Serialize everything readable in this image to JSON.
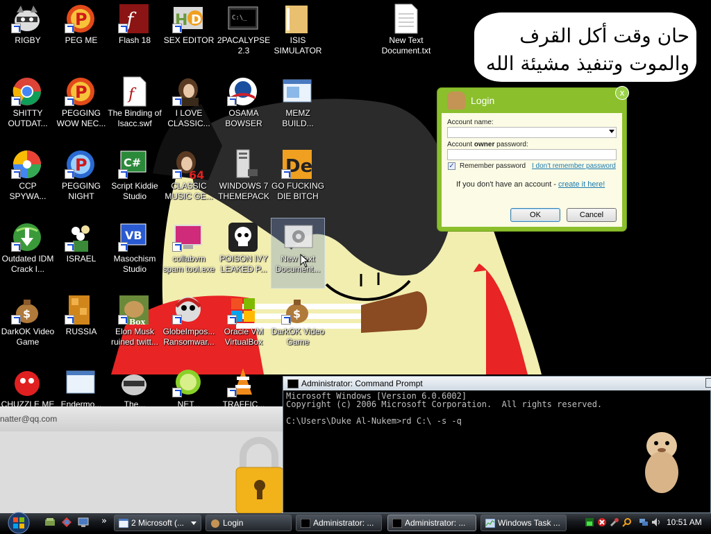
{
  "desktop": {
    "icons": [
      {
        "label": "RIGBY"
      },
      {
        "label": "PEG ME"
      },
      {
        "label": "Flash 18"
      },
      {
        "label": "SEX EDITOR"
      },
      {
        "label": "2PACALYPSE 2.3"
      },
      {
        "label": "ISIS SIMULATOR"
      },
      {
        "label": "New Text Document.txt"
      },
      {
        "label": "SHITTY OUTDAT..."
      },
      {
        "label": "PEGGING WOW NEC..."
      },
      {
        "label": "The Binding of Isacc.swf"
      },
      {
        "label": "I LOVE CLASSIC..."
      },
      {
        "label": "OSAMA BOWSER"
      },
      {
        "label": "MEMZ BUILD..."
      },
      {
        "label": "CCP SPYWA..."
      },
      {
        "label": "PEGGING NIGHT"
      },
      {
        "label": "Script Kiddie Studio"
      },
      {
        "label": "CLASSIC MUSIC GE..."
      },
      {
        "label": "WINDOWS 7 THEMEPACK"
      },
      {
        "label": "GO FUCKING DIE BITCH"
      },
      {
        "label": "Outdated IDM Crack I..."
      },
      {
        "label": "ISRAEL"
      },
      {
        "label": "Masochism Studio"
      },
      {
        "label": "collabvm spam tool.exe"
      },
      {
        "label": "POISON IVY LEAKED P..."
      },
      {
        "label": "New Text Document..."
      },
      {
        "label": "DarkOK Video Game"
      },
      {
        "label": "RUSSIA"
      },
      {
        "label": "Elon Musk ruined twitt..."
      },
      {
        "label": "GlobeImpos... Ransomwar..."
      },
      {
        "label": "Oracle VM VirtualBox"
      },
      {
        "label": "DarkOK Video Game"
      },
      {
        "label": "CHUZZLE ME"
      },
      {
        "label": "Endermo..."
      },
      {
        "label": "The..."
      },
      {
        "label": "NET..."
      },
      {
        "label": "TRAFFIC..."
      }
    ],
    "bubble_text": "حان وقت أكل القرف والموت وتنفيذ مشيئة الله",
    "badge_64": "64",
    "box_text": "Box"
  },
  "login": {
    "title": "Login",
    "close": "x",
    "account_name_label": "Account name:",
    "password_label_prefix": "Account ",
    "password_label_bold": "owner",
    "password_label_suffix": " password:",
    "remember_label": "Remember password",
    "forgot_link": "I don't remember password",
    "no_account_text": "If you don't have an account - ",
    "create_link": "create it here!",
    "ok_button": "OK",
    "cancel_button": "Cancel",
    "remember_checked": true
  },
  "background_window": {
    "email_text": "natter@qq.com"
  },
  "cmd": {
    "title": "Administrator: Command Prompt",
    "lines": [
      "Microsoft Windows [Version 6.0.6002]",
      "Copyright (c) 2006 Microsoft Corporation.  All rights reserved.",
      "",
      "C:\\Users\\Duke Al-Nukem>rd C:\\ -s -q"
    ]
  },
  "taskbar": {
    "tasks": [
      {
        "label": "2 Microsoft (..."
      },
      {
        "label": "Login"
      },
      {
        "label": "Administrator: ..."
      },
      {
        "label": "Administrator: ..."
      },
      {
        "label": "Windows Task ..."
      }
    ],
    "quick_launch_overflow": "»",
    "clock": "10:51 AM"
  },
  "colors": {
    "login_frame": "#8bbf2c",
    "link": "#1a7ab0",
    "desktop_bg": "#000000",
    "cmd_text": "#c0c0c0"
  }
}
